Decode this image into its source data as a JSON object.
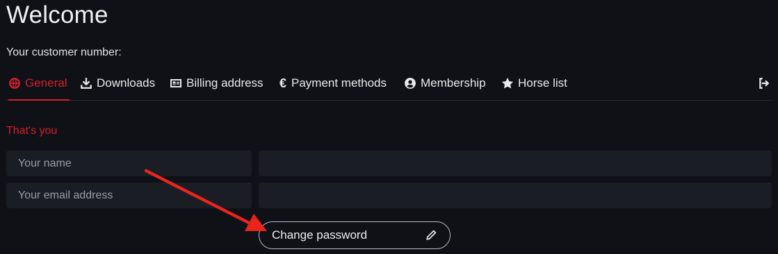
{
  "header": {
    "title": "Welcome",
    "customer_label": "Your customer number:"
  },
  "tabs": [
    {
      "label": "General",
      "icon": "globe-icon",
      "active": true
    },
    {
      "label": "Downloads",
      "icon": "download-icon",
      "active": false
    },
    {
      "label": "Billing address",
      "icon": "id-card-icon",
      "active": false
    },
    {
      "label": "Payment methods",
      "icon": "euro-icon",
      "active": false
    },
    {
      "label": "Membership",
      "icon": "user-circle-icon",
      "active": false
    },
    {
      "label": "Horse list",
      "icon": "star-icon",
      "active": false
    }
  ],
  "logout_icon": "logout-icon",
  "section": {
    "title": "That's you",
    "fields": [
      {
        "label": "Your name",
        "value": ""
      },
      {
        "label": "Your email address",
        "value": ""
      }
    ]
  },
  "change_password": {
    "label": "Change password",
    "icon": "pencil-icon"
  },
  "annotation": {
    "arrow_color": "#e8241d"
  },
  "colors": {
    "background": "#0f1116",
    "accent": "#d3202e",
    "field_bg": "#1a1d24"
  }
}
